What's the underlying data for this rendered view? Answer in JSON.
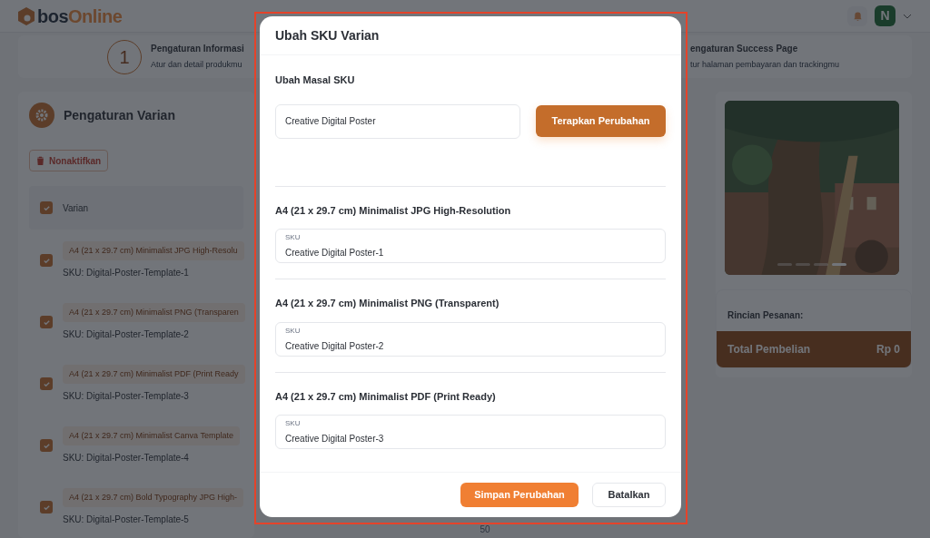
{
  "header": {
    "logo_prefix": "bos",
    "logo_suffix": "Online",
    "avatar": "N"
  },
  "steps": [
    {
      "number": "1",
      "title": "Pengaturan Informasi",
      "subtitle": "Atur dan detail produkmu"
    },
    {
      "title": "engaturan Success Page",
      "subtitle": "tur halaman pembayaran dan trackingmu"
    }
  ],
  "variant_panel": {
    "title": "Pengaturan Varian",
    "disable_button": "Nonaktifkan",
    "header": {
      "label": "Varian",
      "checked": true
    },
    "rows": [
      {
        "name": "A4 (21 x 29.7 cm) Minimalist JPG High-Resolu",
        "sku": "SKU: Digital-Poster-Template-1",
        "checked": true
      },
      {
        "name": "A4 (21 x 29.7 cm) Minimalist PNG (Transparen",
        "sku": "SKU: Digital-Poster-Template-2",
        "checked": true
      },
      {
        "name": "A4 (21 x 29.7 cm) Minimalist PDF (Print Ready",
        "sku": "SKU: Digital-Poster-Template-3",
        "checked": true
      },
      {
        "name": "A4 (21 x 29.7 cm) Minimalist Canva Template",
        "sku": "SKU: Digital-Poster-Template-4",
        "checked": true
      },
      {
        "name": "A4 (21 x 29.7 cm) Bold Typography JPG High-",
        "sku": "SKU: Digital-Poster-Template-5",
        "checked": true
      }
    ]
  },
  "center_tick": "50",
  "preview": {
    "carousel": [
      {
        "selected": false
      },
      {
        "selected": false
      },
      {
        "selected": false
      },
      {
        "selected": true
      }
    ]
  },
  "summary": {
    "title": "Rincian Pesanan:",
    "total_label": "Total Pembelian",
    "total_value": "Rp 0"
  },
  "dialog": {
    "title": "Ubah SKU Varian",
    "bulk": {
      "label": "Ubah Masal SKU",
      "value": "Creative Digital Poster",
      "apply_button": "Terapkan Perubahan"
    },
    "variants": [
      {
        "name": "A4 (21 x 29.7 cm) Minimalist JPG High-Resolution",
        "field_label": "SKU",
        "value": "Creative Digital Poster-1"
      },
      {
        "name": "A4 (21 x 29.7 cm) Minimalist PNG (Transparent)",
        "field_label": "SKU",
        "value": "Creative Digital Poster-2"
      },
      {
        "name": "A4 (21 x 29.7 cm) Minimalist PDF (Print Ready)",
        "field_label": "SKU",
        "value": "Creative Digital Poster-3"
      }
    ],
    "save_button": "Simpan Perubahan",
    "cancel_button": "Batalkan"
  }
}
